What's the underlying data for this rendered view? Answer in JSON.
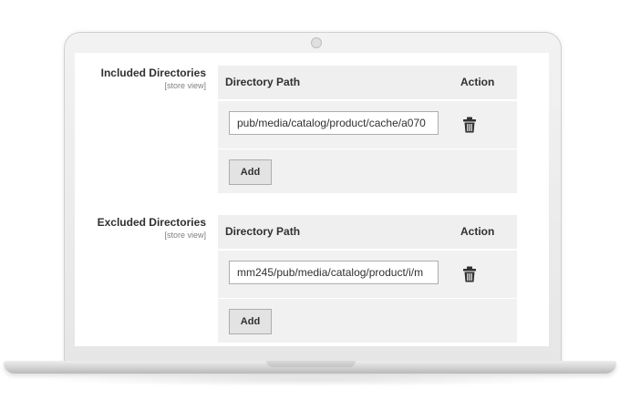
{
  "included": {
    "label": "Included Directories",
    "scope": "[store view]",
    "columns": {
      "path": "Directory Path",
      "action": "Action"
    },
    "rows": [
      {
        "path": "pub/media/catalog/product/cache/a070"
      }
    ],
    "add_label": "Add"
  },
  "excluded": {
    "label": "Excluded Directories",
    "scope": "[store view]",
    "columns": {
      "path": "Directory Path",
      "action": "Action"
    },
    "rows": [
      {
        "path": "mm245/pub/media/catalog/product/i/m"
      }
    ],
    "add_label": "Add"
  },
  "icons": {
    "delete": "trash-icon"
  },
  "colors": {
    "grid_bg": "#efefef",
    "text": "#303030",
    "scope_text": "#808080"
  }
}
